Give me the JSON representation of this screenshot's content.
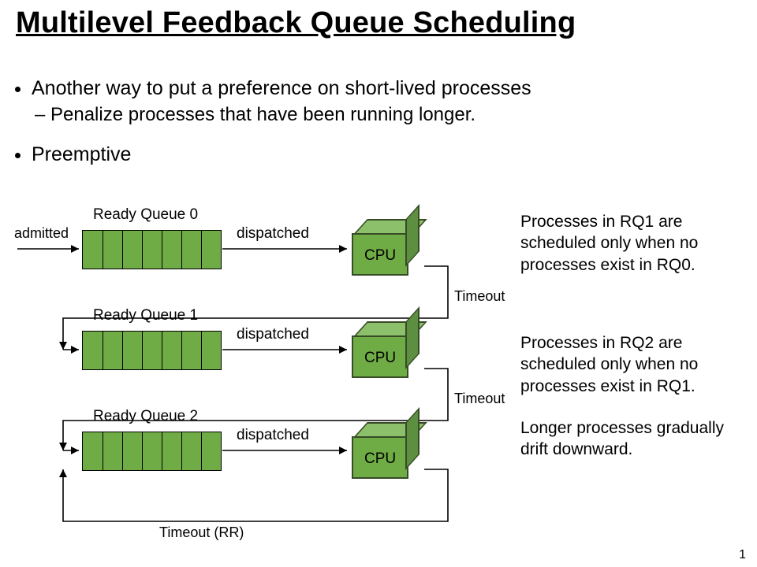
{
  "title": "Multilevel Feedback Queue Scheduling",
  "bullets": {
    "b1": "Another way to put a preference on short-lived processes",
    "b1a": "Penalize processes that have been running longer.",
    "b2": "Preemptive"
  },
  "labels": {
    "admitted": "admitted",
    "dispatched": "dispatched",
    "timeout": "Timeout",
    "timeoutRR": "Timeout (RR)",
    "rq0": "Ready  Queue 0",
    "rq1": "Ready  Queue 1",
    "rq2": "Ready  Queue 2",
    "cpu": "CPU"
  },
  "side": {
    "p1": "Processes in RQ1 are scheduled only when no processes exist in RQ0.",
    "p2": "Processes in RQ2 are scheduled only when no processes exist in RQ1.",
    "p3": "Longer processes gradually drift downward."
  },
  "pagenum": "1",
  "colors": {
    "green": "#6fac46"
  }
}
